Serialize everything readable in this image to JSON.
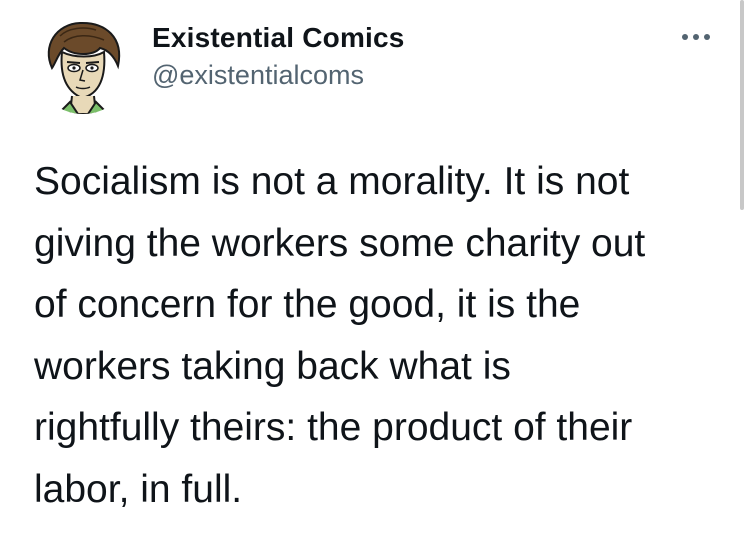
{
  "tweet": {
    "author_name": "Existential Comics",
    "author_handle": "@existentialcoms",
    "text_lines": [
      "Socialism is not a morality. It is not",
      "giving the workers some charity out",
      "of concern for the good, it is the",
      "workers taking back what is",
      "rightfully theirs: the product of their",
      "labor, in full."
    ]
  },
  "icons": {
    "more": "more-horizontal-icon",
    "avatar": "cartoon-philosopher-avatar"
  },
  "colors": {
    "text": "#0f1419",
    "secondary": "#536471",
    "background": "#ffffff"
  }
}
